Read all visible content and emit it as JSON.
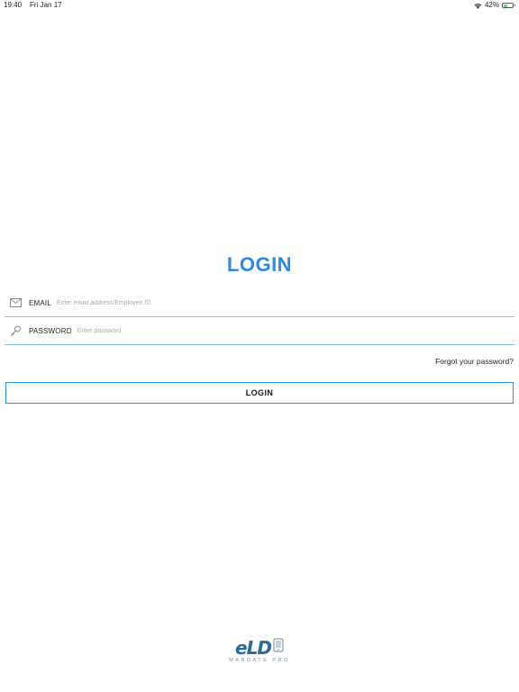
{
  "status_bar": {
    "time": "19:40",
    "date": "Fri Jan 17",
    "battery_percent": "42%",
    "battery_level": 0.42,
    "wifi_icon": "wifi-icon",
    "battery_icon": "battery-icon"
  },
  "login": {
    "title": "LOGIN",
    "email": {
      "icon": "envelope-icon",
      "label": "EMAIL",
      "value": "",
      "placeholder": "Enter email address/Employee ID"
    },
    "password": {
      "icon": "key-icon",
      "label": "PASSWORD",
      "value": "",
      "placeholder": "Enter password"
    },
    "forgot_password": "Forgot your password?",
    "submit_label": "LOGIN"
  },
  "logo": {
    "text": "eLD",
    "subtitle": "MANDATE PRO"
  },
  "colors": {
    "accent": "#2a8be2",
    "field_line": "#8cc4ea",
    "logo": "#2c6a99"
  }
}
